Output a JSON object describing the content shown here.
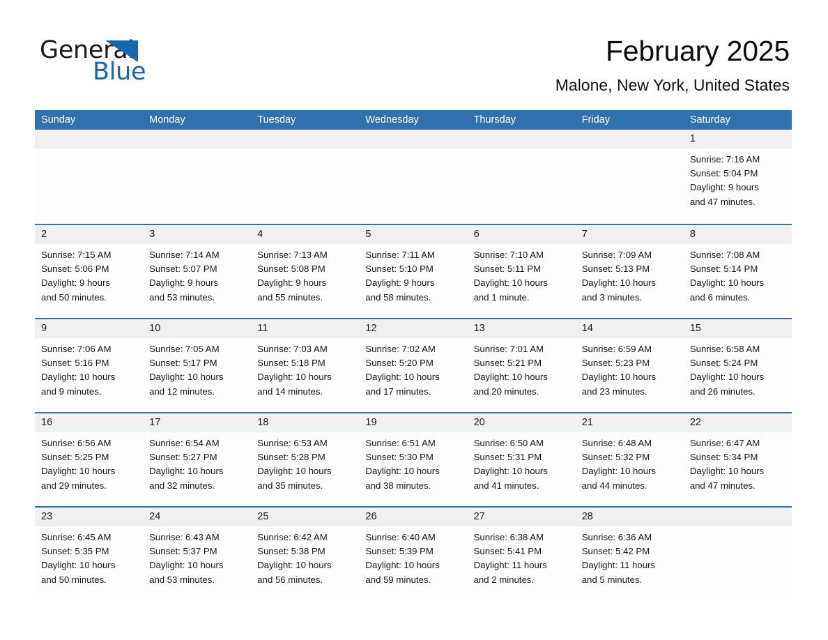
{
  "brand": {
    "name_part1": "General",
    "name_part2": "Blue",
    "accent_color": "#1567b0"
  },
  "header": {
    "month_title": "February 2025",
    "location": "Malone, New York, United States"
  },
  "theme": {
    "header_blue": "#3071b0",
    "row_rule_blue": "#3071b0",
    "day_band_gray": "#f0f0f0"
  },
  "weekdays": [
    "Sunday",
    "Monday",
    "Tuesday",
    "Wednesday",
    "Thursday",
    "Friday",
    "Saturday"
  ],
  "weeks": [
    [
      {
        "day": "",
        "lines": []
      },
      {
        "day": "",
        "lines": []
      },
      {
        "day": "",
        "lines": []
      },
      {
        "day": "",
        "lines": []
      },
      {
        "day": "",
        "lines": []
      },
      {
        "day": "",
        "lines": []
      },
      {
        "day": "1",
        "lines": [
          "Sunrise: 7:16 AM",
          "Sunset: 5:04 PM",
          "Daylight: 9 hours",
          "and 47 minutes."
        ]
      }
    ],
    [
      {
        "day": "2",
        "lines": [
          "Sunrise: 7:15 AM",
          "Sunset: 5:06 PM",
          "Daylight: 9 hours",
          "and 50 minutes."
        ]
      },
      {
        "day": "3",
        "lines": [
          "Sunrise: 7:14 AM",
          "Sunset: 5:07 PM",
          "Daylight: 9 hours",
          "and 53 minutes."
        ]
      },
      {
        "day": "4",
        "lines": [
          "Sunrise: 7:13 AM",
          "Sunset: 5:08 PM",
          "Daylight: 9 hours",
          "and 55 minutes."
        ]
      },
      {
        "day": "5",
        "lines": [
          "Sunrise: 7:11 AM",
          "Sunset: 5:10 PM",
          "Daylight: 9 hours",
          "and 58 minutes."
        ]
      },
      {
        "day": "6",
        "lines": [
          "Sunrise: 7:10 AM",
          "Sunset: 5:11 PM",
          "Daylight: 10 hours",
          "and 1 minute."
        ]
      },
      {
        "day": "7",
        "lines": [
          "Sunrise: 7:09 AM",
          "Sunset: 5:13 PM",
          "Daylight: 10 hours",
          "and 3 minutes."
        ]
      },
      {
        "day": "8",
        "lines": [
          "Sunrise: 7:08 AM",
          "Sunset: 5:14 PM",
          "Daylight: 10 hours",
          "and 6 minutes."
        ]
      }
    ],
    [
      {
        "day": "9",
        "lines": [
          "Sunrise: 7:06 AM",
          "Sunset: 5:16 PM",
          "Daylight: 10 hours",
          "and 9 minutes."
        ]
      },
      {
        "day": "10",
        "lines": [
          "Sunrise: 7:05 AM",
          "Sunset: 5:17 PM",
          "Daylight: 10 hours",
          "and 12 minutes."
        ]
      },
      {
        "day": "11",
        "lines": [
          "Sunrise: 7:03 AM",
          "Sunset: 5:18 PM",
          "Daylight: 10 hours",
          "and 14 minutes."
        ]
      },
      {
        "day": "12",
        "lines": [
          "Sunrise: 7:02 AM",
          "Sunset: 5:20 PM",
          "Daylight: 10 hours",
          "and 17 minutes."
        ]
      },
      {
        "day": "13",
        "lines": [
          "Sunrise: 7:01 AM",
          "Sunset: 5:21 PM",
          "Daylight: 10 hours",
          "and 20 minutes."
        ]
      },
      {
        "day": "14",
        "lines": [
          "Sunrise: 6:59 AM",
          "Sunset: 5:23 PM",
          "Daylight: 10 hours",
          "and 23 minutes."
        ]
      },
      {
        "day": "15",
        "lines": [
          "Sunrise: 6:58 AM",
          "Sunset: 5:24 PM",
          "Daylight: 10 hours",
          "and 26 minutes."
        ]
      }
    ],
    [
      {
        "day": "16",
        "lines": [
          "Sunrise: 6:56 AM",
          "Sunset: 5:25 PM",
          "Daylight: 10 hours",
          "and 29 minutes."
        ]
      },
      {
        "day": "17",
        "lines": [
          "Sunrise: 6:54 AM",
          "Sunset: 5:27 PM",
          "Daylight: 10 hours",
          "and 32 minutes."
        ]
      },
      {
        "day": "18",
        "lines": [
          "Sunrise: 6:53 AM",
          "Sunset: 5:28 PM",
          "Daylight: 10 hours",
          "and 35 minutes."
        ]
      },
      {
        "day": "19",
        "lines": [
          "Sunrise: 6:51 AM",
          "Sunset: 5:30 PM",
          "Daylight: 10 hours",
          "and 38 minutes."
        ]
      },
      {
        "day": "20",
        "lines": [
          "Sunrise: 6:50 AM",
          "Sunset: 5:31 PM",
          "Daylight: 10 hours",
          "and 41 minutes."
        ]
      },
      {
        "day": "21",
        "lines": [
          "Sunrise: 6:48 AM",
          "Sunset: 5:32 PM",
          "Daylight: 10 hours",
          "and 44 minutes."
        ]
      },
      {
        "day": "22",
        "lines": [
          "Sunrise: 6:47 AM",
          "Sunset: 5:34 PM",
          "Daylight: 10 hours",
          "and 47 minutes."
        ]
      }
    ],
    [
      {
        "day": "23",
        "lines": [
          "Sunrise: 6:45 AM",
          "Sunset: 5:35 PM",
          "Daylight: 10 hours",
          "and 50 minutes."
        ]
      },
      {
        "day": "24",
        "lines": [
          "Sunrise: 6:43 AM",
          "Sunset: 5:37 PM",
          "Daylight: 10 hours",
          "and 53 minutes."
        ]
      },
      {
        "day": "25",
        "lines": [
          "Sunrise: 6:42 AM",
          "Sunset: 5:38 PM",
          "Daylight: 10 hours",
          "and 56 minutes."
        ]
      },
      {
        "day": "26",
        "lines": [
          "Sunrise: 6:40 AM",
          "Sunset: 5:39 PM",
          "Daylight: 10 hours",
          "and 59 minutes."
        ]
      },
      {
        "day": "27",
        "lines": [
          "Sunrise: 6:38 AM",
          "Sunset: 5:41 PM",
          "Daylight: 11 hours",
          "and 2 minutes."
        ]
      },
      {
        "day": "28",
        "lines": [
          "Sunrise: 6:36 AM",
          "Sunset: 5:42 PM",
          "Daylight: 11 hours",
          "and 5 minutes."
        ]
      },
      {
        "day": "",
        "lines": []
      }
    ]
  ]
}
